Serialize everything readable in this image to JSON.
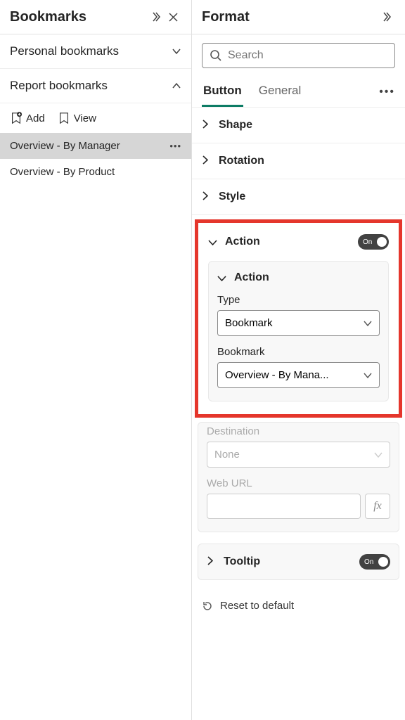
{
  "bookmarks": {
    "title": "Bookmarks",
    "personal": {
      "label": "Personal bookmarks",
      "expanded": false
    },
    "report": {
      "label": "Report bookmarks",
      "expanded": true,
      "toolbar": {
        "add": "Add",
        "view": "View"
      },
      "items": [
        {
          "label": "Overview - By Manager",
          "selected": true
        },
        {
          "label": "Overview - By Product",
          "selected": false
        }
      ]
    }
  },
  "format": {
    "title": "Format",
    "search_placeholder": "Search",
    "tabs": {
      "button": "Button",
      "general": "General"
    },
    "sections": {
      "shape": "Shape",
      "rotation": "Rotation",
      "style": "Style",
      "action": {
        "label": "Action",
        "on": "On",
        "inner_label": "Action",
        "type_label": "Type",
        "type_value": "Bookmark",
        "bookmark_label": "Bookmark",
        "bookmark_value": "Overview - By Mana...",
        "destination_label": "Destination",
        "destination_value": "None",
        "weburl_label": "Web URL",
        "fx": "fx"
      },
      "tooltip": {
        "label": "Tooltip",
        "on": "On"
      }
    },
    "reset": "Reset to default"
  }
}
